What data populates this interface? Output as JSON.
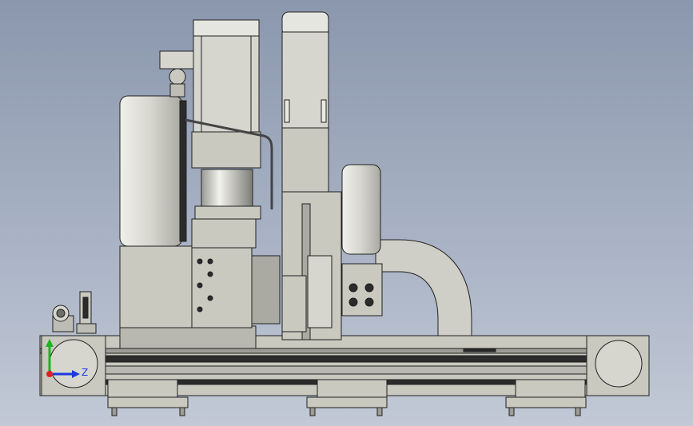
{
  "viewport": {
    "background_top": "#8b97ad",
    "background_bottom": "#c2c9d6"
  },
  "model": {
    "body_color": "#c9c9c0",
    "edge_color": "#202020",
    "dark_color": "#2b2b2b",
    "cylinder_highlight": "#f2f2ee"
  },
  "triad": {
    "x_color": "#e02020",
    "y_color": "#1db41d",
    "z_color": "#1a3adb",
    "z_label": "Z"
  },
  "icons": [
    "coordinate-triad-icon",
    "cable-connector-icon"
  ]
}
